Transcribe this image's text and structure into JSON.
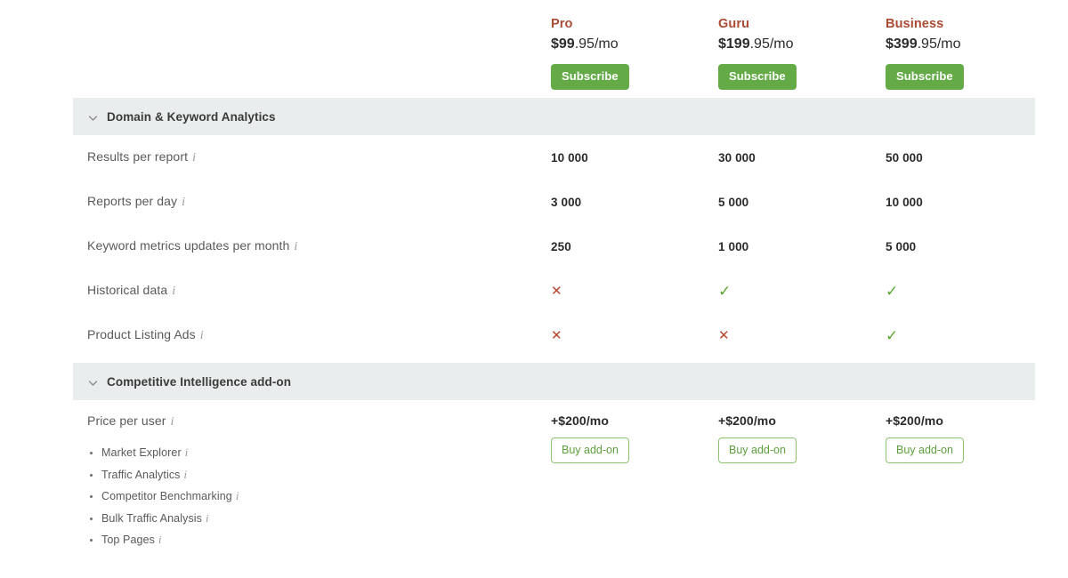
{
  "plans": [
    {
      "name": "Pro",
      "price_amount": "$99",
      "price_suffix": ".95/mo",
      "subscribe_label": "Subscribe"
    },
    {
      "name": "Guru",
      "price_amount": "$199",
      "price_suffix": ".95/mo",
      "subscribe_label": "Subscribe"
    },
    {
      "name": "Business",
      "price_amount": "$399",
      "price_suffix": ".95/mo",
      "subscribe_label": "Subscribe"
    }
  ],
  "sections": [
    {
      "title": "Domain & Keyword Analytics",
      "chevron_icon": "chevron-down-icon",
      "rows": [
        {
          "label": "Results per report",
          "info_icon": "info-icon",
          "values": [
            "10 000",
            "30 000",
            "50 000"
          ]
        },
        {
          "label": "Reports per day",
          "info_icon": "info-icon",
          "values": [
            "3 000",
            "5 000",
            "10 000"
          ]
        },
        {
          "label": "Keyword metrics updates per month",
          "info_icon": "info-icon",
          "values": [
            "250",
            "1 000",
            "5 000"
          ]
        },
        {
          "label": "Historical data",
          "info_icon": "info-icon",
          "values": [
            "✕",
            "✓",
            "✓"
          ],
          "kinds": [
            "no",
            "yes",
            "yes"
          ]
        },
        {
          "label": "Product Listing Ads",
          "info_icon": "info-icon",
          "values": [
            "✕",
            "✕",
            "✓"
          ],
          "kinds": [
            "no",
            "no",
            "yes"
          ]
        }
      ]
    }
  ],
  "addon_section": {
    "title": "Competitive Intelligence add-on",
    "chevron_icon": "chevron-down-icon",
    "price_row_label": "Price per user",
    "info_icon": "info-icon",
    "prices": [
      "+$200/mo",
      "+$200/mo",
      "+$200/mo"
    ],
    "buy_label": "Buy add-on",
    "features": [
      "Market Explorer",
      "Traffic Analytics",
      "Competitor Benchmarking",
      "Bulk Traffic Analysis",
      "Top Pages"
    ]
  },
  "colors": {
    "plan_name": "#ab4b33",
    "accent_green": "#64ab48",
    "section_band": "#eaeded",
    "yes_mark": "#5aa732",
    "no_mark": "#b8462e"
  }
}
